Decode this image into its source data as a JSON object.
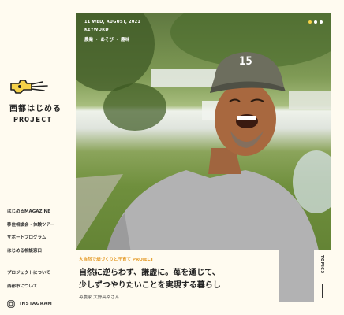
{
  "brand": {
    "title": "西都はじめる",
    "subtitle": "PROJECT",
    "accent": "#f6d248"
  },
  "nav": {
    "items": [
      {
        "label": "はじめるMAGAZINE"
      },
      {
        "label": "移住相談会・体験ツアー"
      },
      {
        "label": "サポートプログラム"
      },
      {
        "label": "はじめる相談窓口"
      }
    ],
    "sub_items": [
      {
        "label": "プロジェクトについて"
      },
      {
        "label": "西都市について"
      }
    ],
    "instagram": {
      "label": "INSTAGRAM",
      "icon": "instagram-icon"
    }
  },
  "hero": {
    "date": "11 WED, AUGUST, 2021",
    "keyword_label": "KEYWORD",
    "tags": "農業 ・ あそび ・ 趣味",
    "slide_dots": [
      "#f6d248",
      "#ffffff",
      "#ffffff"
    ],
    "cap_number": "15"
  },
  "article": {
    "category": "大自然で畑づくりと子育て PROJECT",
    "title_line1": "自然に逆らわず、謙虚に。苺を通じて、",
    "title_line2": "少しずつやりたいことを実現する暮らし",
    "author": "苺農家 大野高幸さん"
  },
  "topics": {
    "label": "TOPICS"
  }
}
